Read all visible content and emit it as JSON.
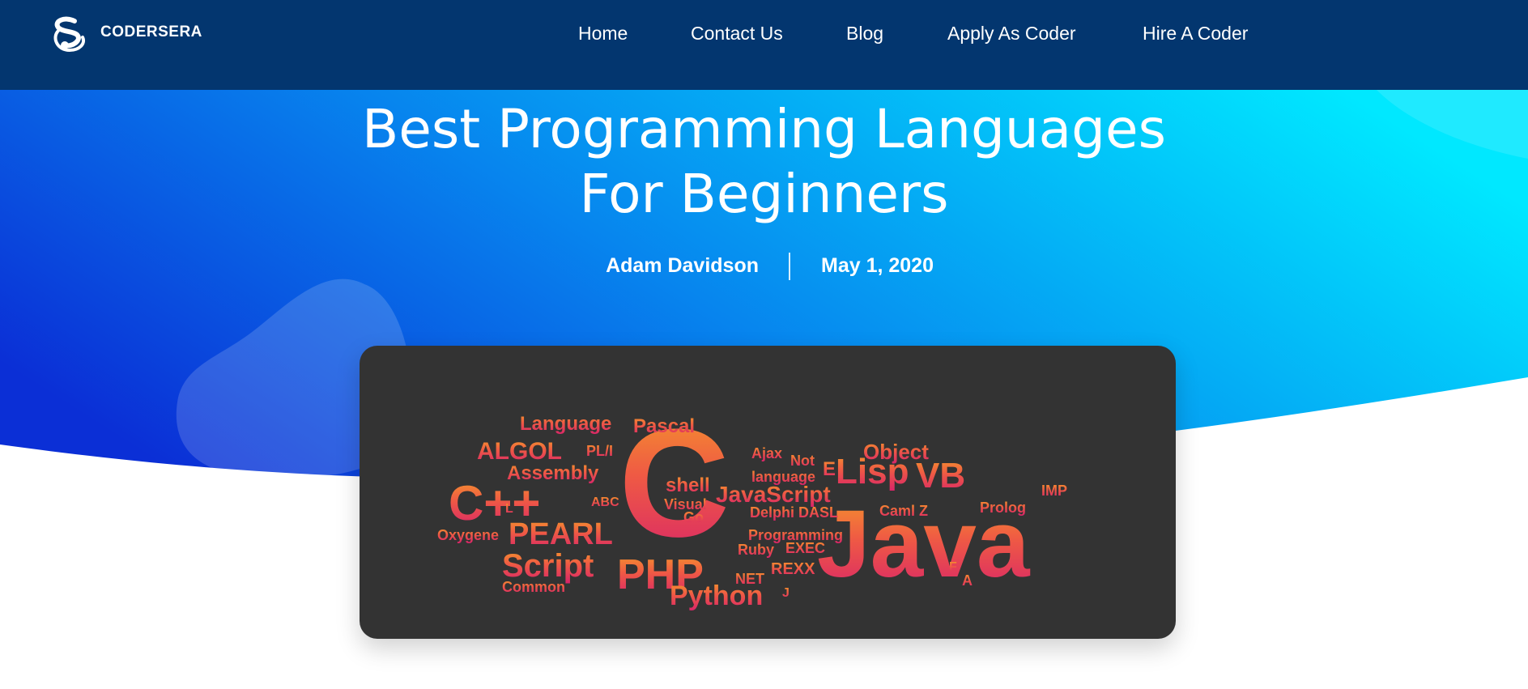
{
  "brand": {
    "name": "CODERSERA"
  },
  "nav": {
    "items": [
      {
        "label": "Home"
      },
      {
        "label": "Contact Us"
      },
      {
        "label": "Blog"
      },
      {
        "label": "Apply As Coder"
      },
      {
        "label": "Hire A Coder"
      }
    ]
  },
  "article": {
    "title_line1": "Best Programming Languages",
    "title_line2": "For Beginners",
    "author": "Adam Davidson",
    "date": "May 1, 2020"
  },
  "hero_image": {
    "words": {
      "java": "Java",
      "c": "C",
      "cpp": "C++",
      "php": "PHP",
      "script": "Script",
      "pearl": "PEARL",
      "python": "Python",
      "lisp": "Lisp",
      "vb": "VB",
      "javascript": "JavaScript",
      "algol": "ALGOL",
      "assembly": "Assembly",
      "language": "Language",
      "pascal": "Pascal",
      "object": "Object",
      "shell": "shell",
      "visual": "Visual",
      "go": "Go",
      "delphi": "Delphi",
      "dasl": "DASL",
      "camlz": "Caml Z",
      "prolog": "Prolog",
      "programming": "Programming",
      "ruby": "Ruby",
      "exec": "EXEC",
      "rexx": "REXX",
      "net": "NET",
      "oxygene": "Oxygene",
      "common": "Common",
      "abc": "ABC",
      "ajax": "Ajax",
      "not": "Not",
      "language_lc": "language",
      "imp": "IMP",
      "e": "E",
      "pli": "PL/I",
      "a": "A",
      "f": "F",
      "l": "L",
      "j": "J"
    }
  },
  "colors": {
    "header_bg": "#03366f",
    "hero_gradient_start": "#0b2fd6",
    "hero_gradient_end": "#00e5ff",
    "card_bg": "#333333",
    "wordcloud_orange": "#f28a2a",
    "wordcloud_pink": "#d8236a"
  },
  "icons": {
    "logo": "codersera-logo-icon"
  }
}
